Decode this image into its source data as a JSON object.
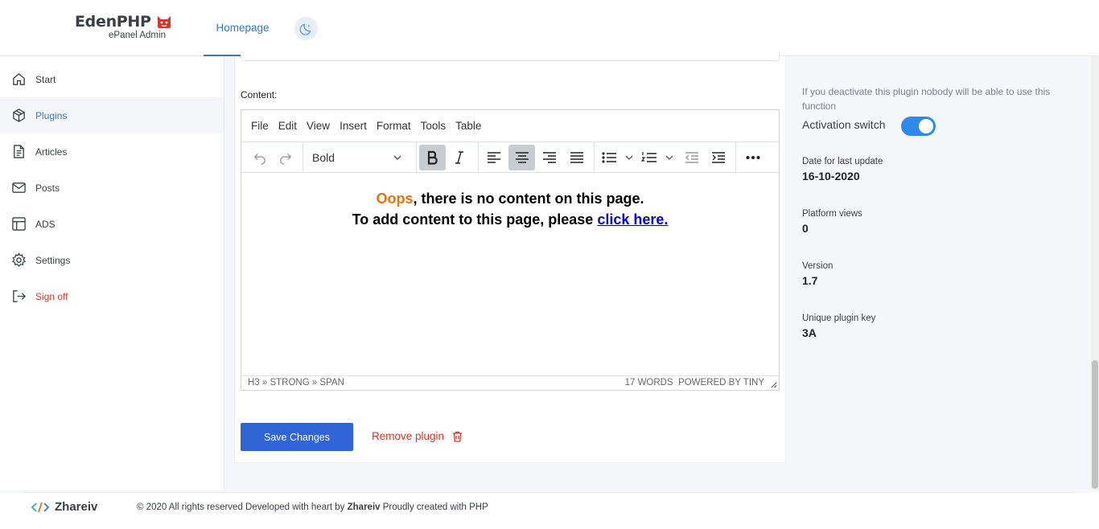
{
  "header": {
    "logo_title": "EdenPHP",
    "logo_subtitle": "ePanel Admin",
    "nav_tab": "Homepage"
  },
  "sidebar": {
    "items": [
      {
        "label": "Start",
        "icon": "home-icon"
      },
      {
        "label": "Plugins",
        "icon": "package-icon",
        "active": true
      },
      {
        "label": "Articles",
        "icon": "document-icon"
      },
      {
        "label": "Posts",
        "icon": "mail-icon"
      },
      {
        "label": "ADS",
        "icon": "layout-icon"
      },
      {
        "label": "Settings",
        "icon": "gear-icon"
      },
      {
        "label": "Sign off",
        "icon": "logout-icon"
      }
    ]
  },
  "main": {
    "content_label": "Content:",
    "editor": {
      "menu": [
        "File",
        "Edit",
        "View",
        "Insert",
        "Format",
        "Tools",
        "Table"
      ],
      "format_value": "Bold",
      "message": {
        "oops": "Oops",
        "line1_rest": ", there is no content on this page.",
        "line2_text": "To add content to this page, please ",
        "link_text": "click here."
      },
      "status_path": "H3 » STRONG » SPAN",
      "word_count": "17 WORDS",
      "powered": "POWERED BY TINY"
    },
    "save_label": "Save Changes",
    "remove_label": "Remove plugin"
  },
  "right_panel": {
    "note": "If you deactivate this plugin nobody will be able to use this function",
    "switch_label": "Activation switch",
    "switch_on": true,
    "fields": [
      {
        "label": "Date for last update",
        "value": "16-10-2020"
      },
      {
        "label": "Platform views",
        "value": "0"
      },
      {
        "label": "Version",
        "value": "1.7"
      },
      {
        "label": "Unique plugin key",
        "value": "3A"
      }
    ]
  },
  "footer": {
    "brand": "Zhareiv",
    "copyright_pre": "© 2020 All rights reserved Developed with heart by ",
    "copyright_brand": "Zhareiv",
    "copyright_post": " Proudly created with PHP"
  },
  "colors": {
    "accent": "#3a7ab8",
    "primary_button": "#3164d4",
    "danger": "#d9342b",
    "oops": "#e8740c",
    "switch": "#2d8ae8"
  }
}
